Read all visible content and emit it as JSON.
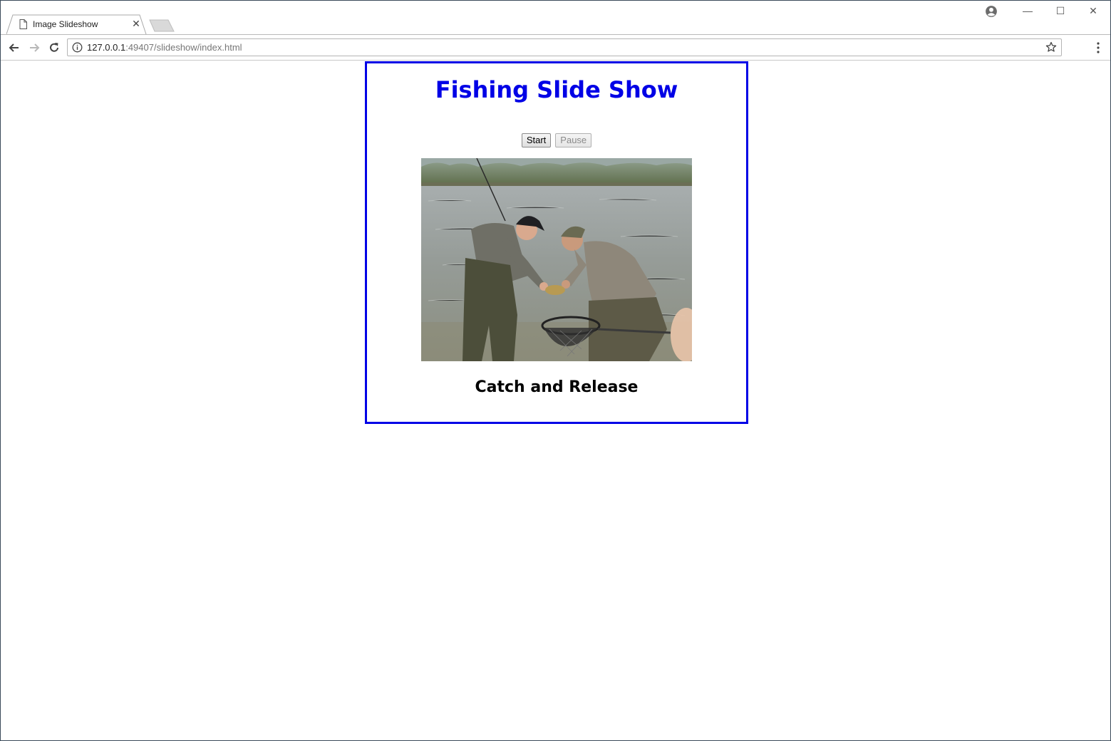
{
  "browser": {
    "tab_title": "Image Slideshow",
    "url_host": "127.0.0.1",
    "url_rest": ":49407/slideshow/index.html",
    "icons": {
      "tab": "page-icon",
      "back": "back-arrow-icon",
      "forward": "forward-arrow-icon",
      "reload": "reload-icon",
      "info": "info-icon",
      "bookmark": "star-icon",
      "menu": "kebab-menu-icon",
      "profile": "account-icon"
    }
  },
  "slideshow": {
    "heading": "Fishing Slide Show",
    "start_label": "Start",
    "pause_label": "Pause",
    "caption": "Catch and Release",
    "accent_color": "#0000e6",
    "photo_description_icon": "fishing-photo"
  }
}
